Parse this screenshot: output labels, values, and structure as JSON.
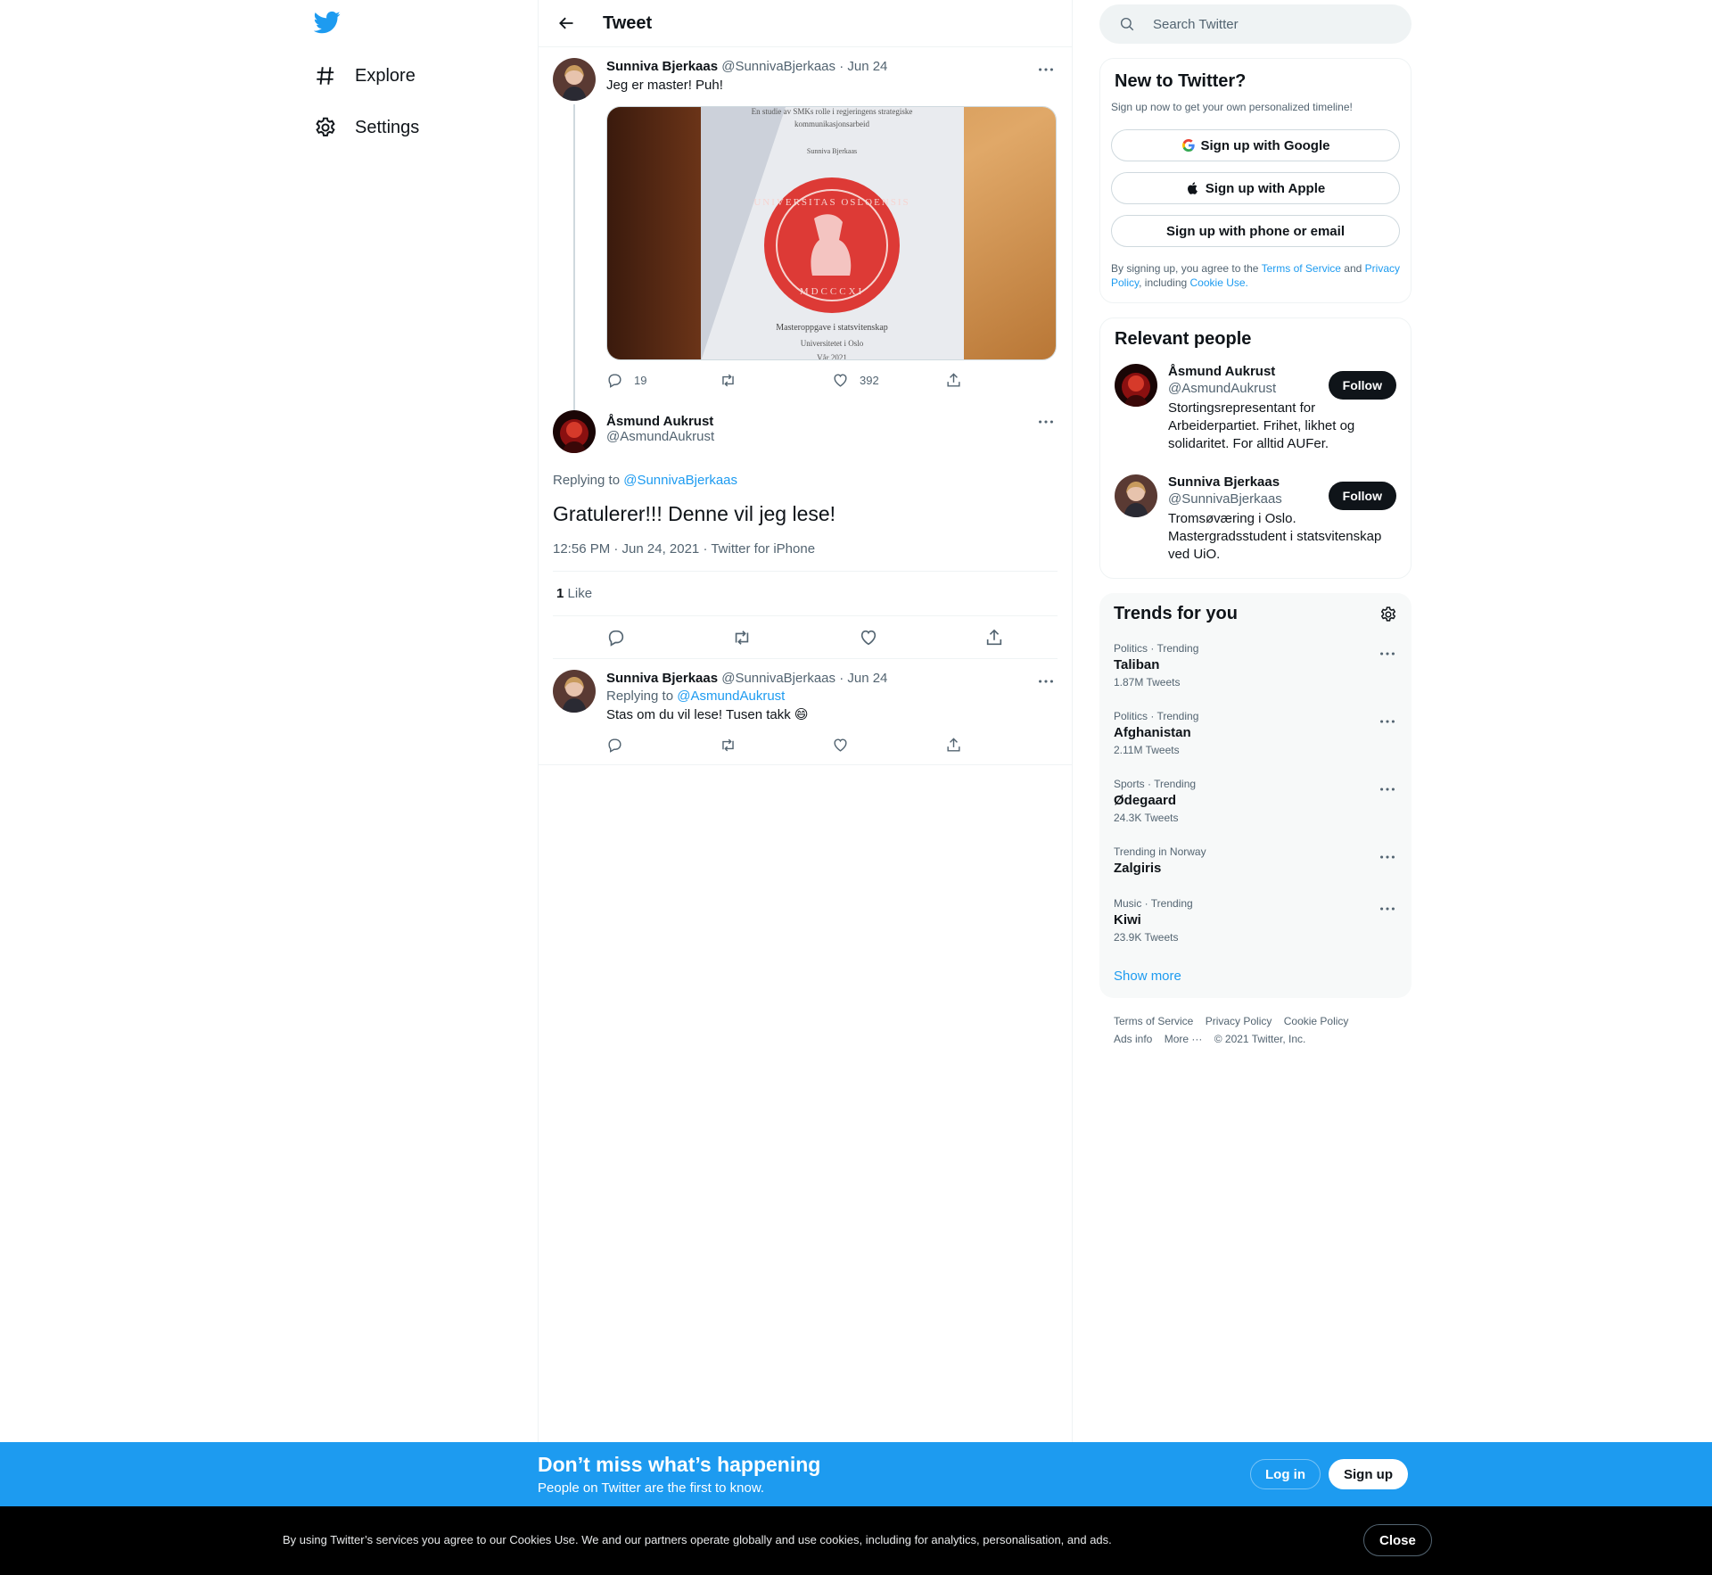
{
  "nav": {
    "items": [
      {
        "label": "Explore",
        "icon": "hashtag-icon"
      },
      {
        "label": "Settings",
        "icon": "gear-icon"
      }
    ]
  },
  "header": {
    "title": "Tweet"
  },
  "tweets": {
    "parent": {
      "name": "Sunniva Bjerkaas",
      "handle": "@SunnivaBjerkaas",
      "date": "· Jun 24",
      "text": "Jeg er master! Puh!",
      "replies": "19",
      "likes": "392",
      "media": {
        "line1": "En studie av SMKs rolle i regjeringens strategiske",
        "line2": "kommunikasjonsarbeid",
        "author": "Sunniva Bjerkaas",
        "seal_text": "UNIVERSITAS OSLOENSIS",
        "seal_year": "MDCCCXI",
        "thesis": "Masteroppgave i statsvitenskap",
        "university": "Universitetet i Oslo",
        "year": "Vår 2021"
      }
    },
    "focused": {
      "name": "Åsmund Aukrust",
      "handle": "@AsmundAukrust",
      "replying_prefix": "Replying to",
      "replying_to": "@SunnivaBjerkaas",
      "text": "Gratulerer!!! Denne vil jeg lese!",
      "meta": "12:56 PM · Jun 24, 2021 · Twitter for iPhone",
      "like_count": "1",
      "like_label": "Like"
    },
    "reply": {
      "name": "Sunniva Bjerkaas",
      "handle": "@SunnivaBjerkaas",
      "date": "· Jun 24",
      "replying_prefix": "Replying to",
      "replying_to": "@AsmundAukrust",
      "text": "Stas om du vil lese! Tusen takk 😄"
    }
  },
  "search": {
    "placeholder": "Search Twitter"
  },
  "new_to_twitter": {
    "title": "New to Twitter?",
    "subtitle": "Sign up now to get your own personalized timeline!",
    "google": "Sign up with Google",
    "apple": "Sign up with Apple",
    "phone": "Sign up with phone or email",
    "legal_1": "By signing up, you agree to the",
    "tos": "Terms of Service",
    "legal_2": "and",
    "privacy": "Privacy Policy",
    "legal_3": ", including",
    "cookie": "Cookie Use."
  },
  "relevant_people": {
    "title": "Relevant people",
    "people": [
      {
        "name": "Åsmund Aukrust",
        "handle": "@AsmundAukrust",
        "bio": "Stortingsrepresentant for Arbeiderpartiet. Frihet, likhet og solidaritet. For alltid AUFer.",
        "button": "Follow"
      },
      {
        "name": "Sunniva Bjerkaas",
        "handle": "@SunnivaBjerkaas",
        "bio": "Tromsøværing i Oslo. Mastergradsstudent i statsvitenskap ved UiO.",
        "button": "Follow"
      }
    ]
  },
  "trends": {
    "title": "Trends for you",
    "items": [
      {
        "category": "Politics · Trending",
        "name": "Taliban",
        "count": "1.87M Tweets"
      },
      {
        "category": "Politics · Trending",
        "name": "Afghanistan",
        "count": "2.11M Tweets"
      },
      {
        "category": "Sports · Trending",
        "name": "Ødegaard",
        "count": "24.3K Tweets"
      },
      {
        "category": "Trending in Norway",
        "name": "Zalgiris",
        "count": ""
      },
      {
        "category": "Music · Trending",
        "name": "Kiwi",
        "count": "23.9K Tweets"
      }
    ],
    "show_more": "Show more"
  },
  "footer": {
    "tos": "Terms of Service",
    "privacy": "Privacy Policy",
    "cookie": "Cookie Policy",
    "ads": "Ads info",
    "more": "More ···",
    "copyright": "© 2021 Twitter, Inc."
  },
  "signup_bar": {
    "title": "Don’t miss what’s happening",
    "subtitle": "People on Twitter are the first to know.",
    "login": "Log in",
    "signup": "Sign up"
  },
  "cookie_bar": {
    "text": "By using Twitter’s services you agree to our Cookies Use. We and our partners operate globally and use cookies, including for analytics, personalisation, and ads.",
    "close": "Close"
  },
  "colors": {
    "accent": "#1d9bf0",
    "text": "#0f1419",
    "secondary": "#536471",
    "border": "#eff3f4"
  }
}
